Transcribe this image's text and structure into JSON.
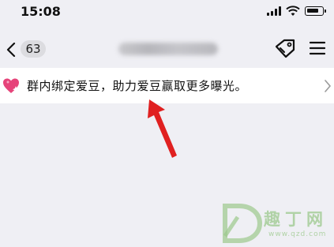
{
  "status_bar": {
    "time": "15:08",
    "icons": [
      "signal-icon",
      "wifi-icon",
      "battery-icon"
    ]
  },
  "nav": {
    "back_count": "63",
    "icons": [
      "back-chevron-icon",
      "tag-icon",
      "menu-icon"
    ]
  },
  "banner": {
    "text": "群内绑定爱豆，助力爱豆赢取更多曝光。",
    "icons": [
      "heart-sparkle-icon",
      "chevron-right-icon"
    ]
  },
  "watermark": {
    "text": "趣丁网",
    "url": "www.qzd.com"
  },
  "colors": {
    "background": "#efeff4",
    "banner_bg": "#ffffff",
    "heart": "#e6447a",
    "arrow": "#e02020",
    "watermark": "#9cc98c"
  }
}
